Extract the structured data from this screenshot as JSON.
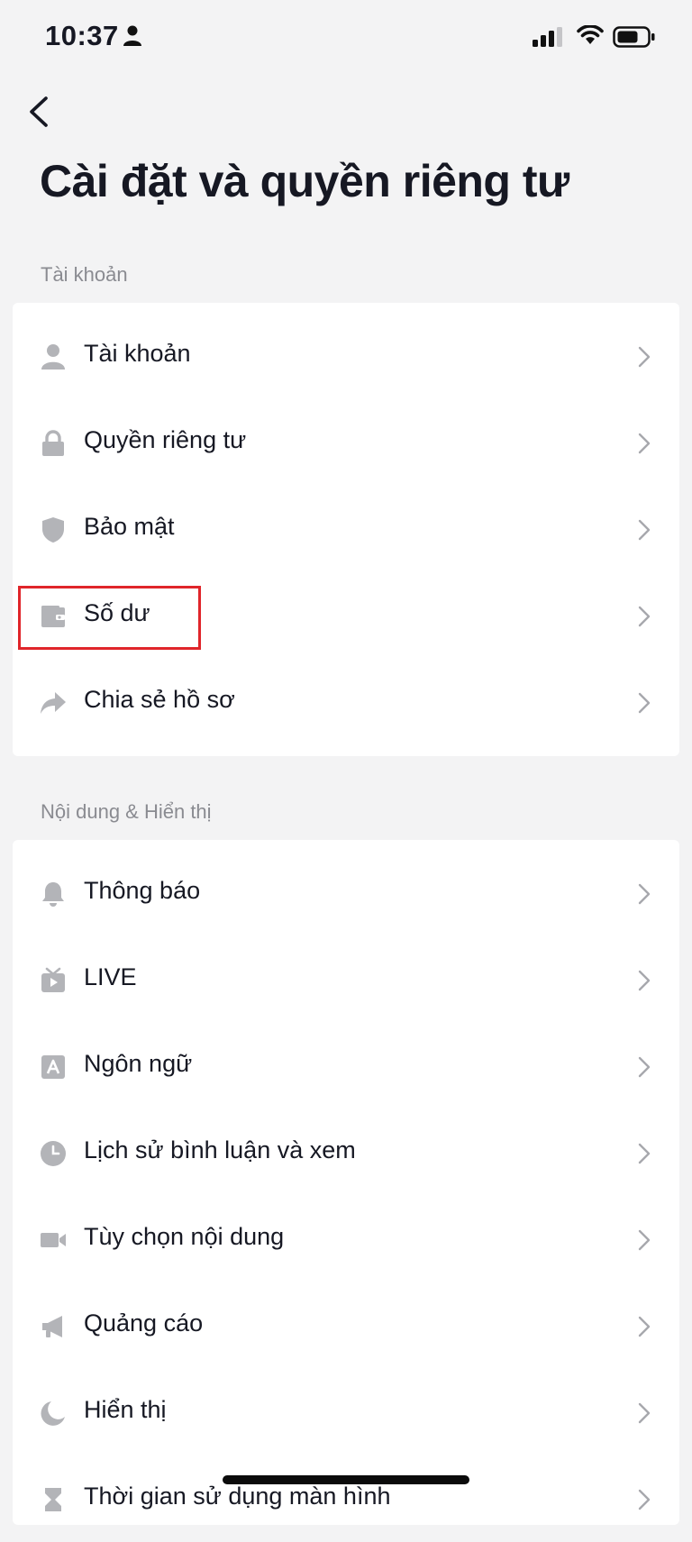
{
  "status_bar": {
    "time": "10:37"
  },
  "header": {
    "title": "Cài đặt và quyền riêng tư"
  },
  "sections": [
    {
      "label": "Tài khoản",
      "items": [
        {
          "label": "Tài khoản",
          "icon": "person-icon"
        },
        {
          "label": "Quyền riêng tư",
          "icon": "lock-icon"
        },
        {
          "label": "Bảo mật",
          "icon": "shield-icon"
        },
        {
          "label": "Số dư",
          "icon": "wallet-icon",
          "highlighted": true
        },
        {
          "label": "Chia sẻ hồ sơ",
          "icon": "share-icon"
        }
      ]
    },
    {
      "label": "Nội dung & Hiển thị",
      "items": [
        {
          "label": "Thông báo",
          "icon": "bell-icon"
        },
        {
          "label": "LIVE",
          "icon": "live-tv-icon"
        },
        {
          "label": "Ngôn ngữ",
          "icon": "language-icon"
        },
        {
          "label": "Lịch sử bình luận và xem",
          "icon": "clock-icon"
        },
        {
          "label": "Tùy chọn nội dung",
          "icon": "video-camera-icon"
        },
        {
          "label": "Quảng cáo",
          "icon": "megaphone-icon"
        },
        {
          "label": "Hiển thị",
          "icon": "moon-icon"
        },
        {
          "label": "Thời gian sử dụng màn hình",
          "icon": "hourglass-icon"
        }
      ]
    }
  ],
  "colors": {
    "highlight": "#e0252a",
    "icon": "#b3b4b8",
    "chevron": "#a7a8ad"
  }
}
